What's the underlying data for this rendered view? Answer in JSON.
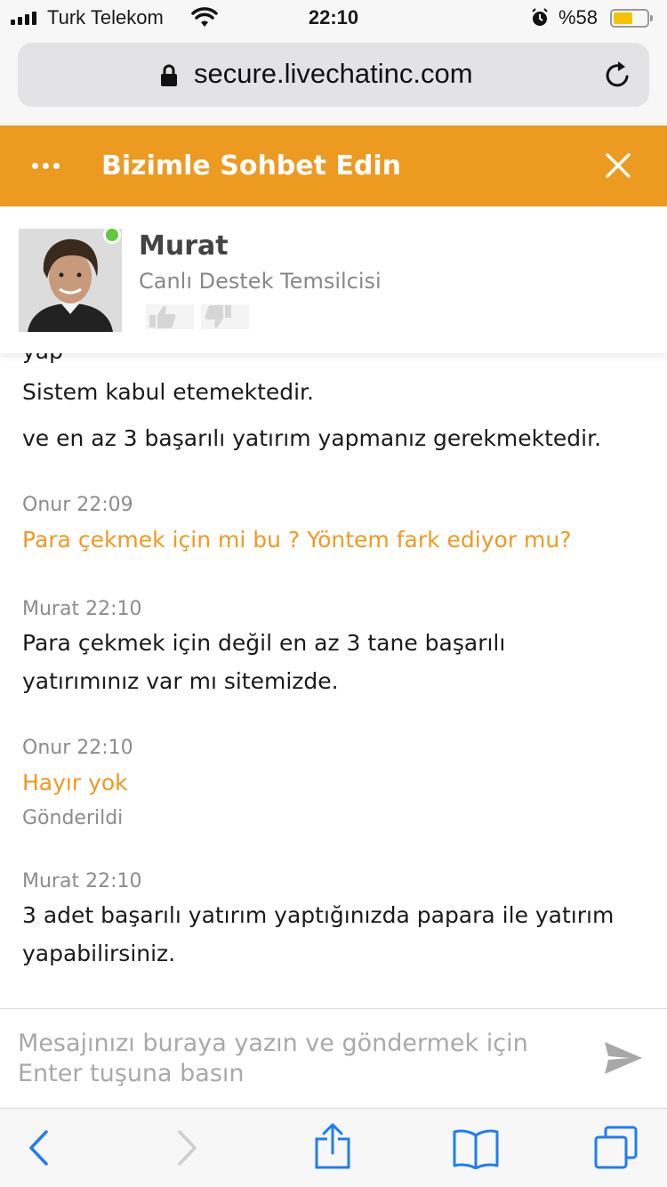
{
  "status_bar": {
    "carrier": "Turk Telekom",
    "time": "22:10",
    "battery_percent": "%58",
    "battery_level": 0.58,
    "icons": [
      "signal-icon",
      "wifi-icon",
      "alarm-icon",
      "battery-icon"
    ]
  },
  "browser": {
    "url": "secure.livechatinc.com",
    "icons": [
      "lock-icon",
      "reload-icon"
    ]
  },
  "chat_header": {
    "title": "Bizimle Sohbet Edin",
    "accent_color": "#ed9a21",
    "icons": [
      "more-icon",
      "close-icon"
    ]
  },
  "agent": {
    "name": "Murat",
    "role": "Canlı Destek Temsilcisi",
    "status_color": "#5ccb3b",
    "icons": [
      "thumbs-up-icon",
      "thumbs-down-icon"
    ]
  },
  "messages": [
    {
      "author": "agent",
      "lines": [
        "Sistem kabul etemektedir."
      ]
    },
    {
      "author": "agent",
      "lines": [
        "ve en az 3 başarılı yatırım yapmanız gerekmektedir."
      ]
    },
    {
      "author": "visitor",
      "meta": "Onur 22:09",
      "lines": [
        "Para çekmek için mi bu ? Yöntem fark ediyor mu?"
      ]
    },
    {
      "author": "agent",
      "meta": "Murat 22:10",
      "lines": [
        "Para çekmek için değil en az 3 tane başarılı",
        "yatırımınız var mı sitemizde."
      ]
    },
    {
      "author": "visitor",
      "meta": "Onur 22:10",
      "lines": [
        "Hayır yok"
      ],
      "status": "Gönderildi"
    },
    {
      "author": "agent",
      "meta": "Murat 22:10",
      "lines": [
        "3 adet başarılı yatırım yaptığınızda papara ile yatırım",
        "yapabilirsiniz."
      ]
    }
  ],
  "composer": {
    "placeholder": "Mesajınızı buraya yazın ve göndermek için Enter tuşuna basın",
    "icons": [
      "send-icon"
    ]
  },
  "toolbar": {
    "icons": [
      "back-icon",
      "forward-icon",
      "share-icon",
      "bookmarks-icon",
      "tabs-icon"
    ],
    "accent_color": "#1f7cf6"
  }
}
